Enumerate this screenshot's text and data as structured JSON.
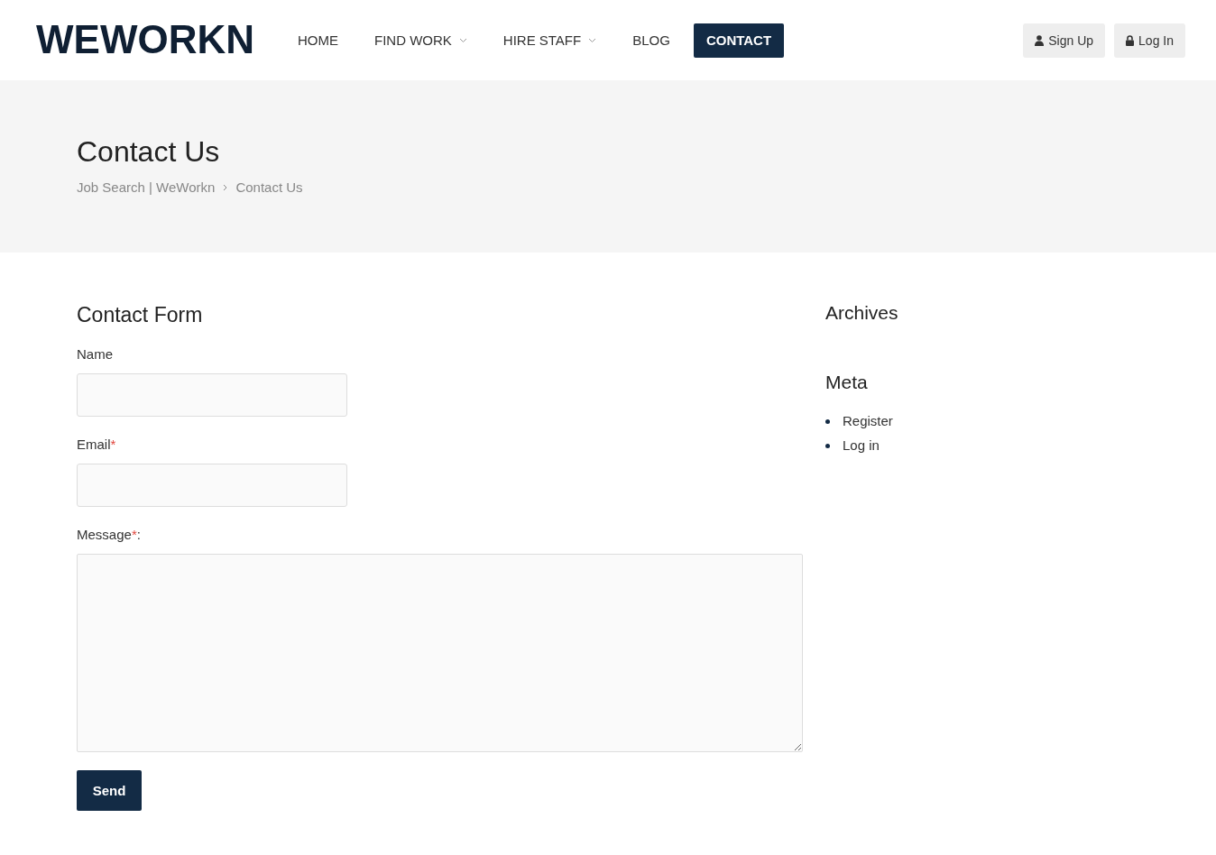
{
  "header": {
    "logo": "WEWORKN",
    "nav": [
      {
        "label": "HOME",
        "selected": false,
        "has_dropdown": false
      },
      {
        "label": "FIND WORK",
        "selected": false,
        "has_dropdown": true
      },
      {
        "label": "HIRE STAFF",
        "selected": false,
        "has_dropdown": true
      },
      {
        "label": "BLOG",
        "selected": false,
        "has_dropdown": false
      },
      {
        "label": "CONTACT",
        "selected": true,
        "has_dropdown": false
      }
    ],
    "account_buttons": [
      {
        "label": "Sign Up",
        "kind": "user"
      },
      {
        "label": "Log In",
        "kind": "lock"
      }
    ]
  },
  "page_banner": {
    "title": "Contact Us",
    "breadcrumb": [
      "Job Search | WeWorkn",
      "Contact Us"
    ]
  },
  "contact_form": {
    "title": "Contact Form",
    "fields": [
      {
        "label": "Name",
        "kind": "input"
      },
      {
        "label": "Email",
        "kind": "input",
        "required_mark": "*"
      },
      {
        "label": "Message",
        "kind": "textarea",
        "required_mark": "*",
        "suffix": ":"
      }
    ],
    "submit": "Send"
  },
  "sidebar": {
    "widgets": [
      {
        "title": "Archives"
      },
      {
        "title": "Meta",
        "links": [
          "Register",
          "Log in"
        ]
      }
    ]
  }
}
